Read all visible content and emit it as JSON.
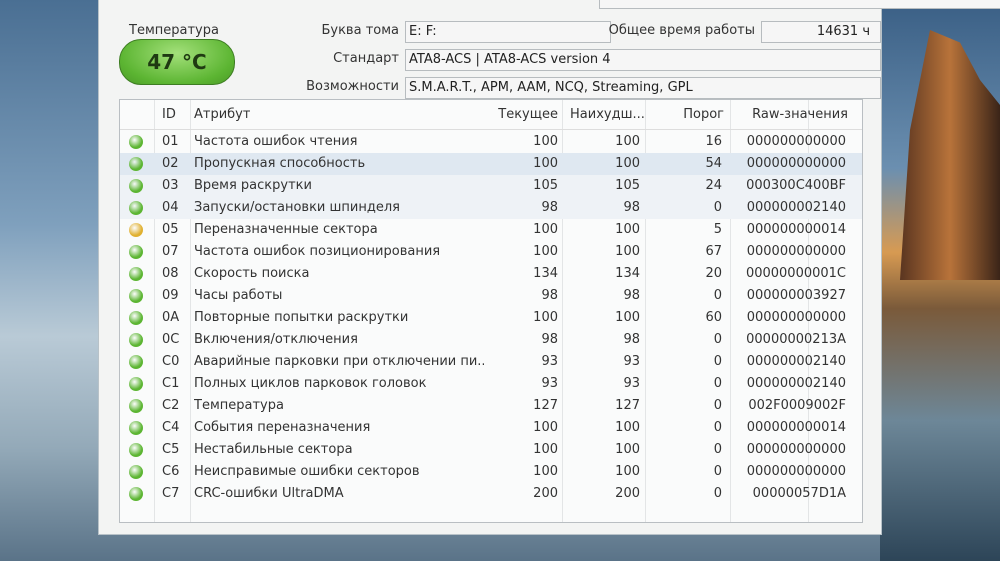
{
  "info": {
    "temperature_label": "Температура",
    "temperature_value": "47 °C",
    "volume_label": "Буква тома",
    "volume_value": "E: F:",
    "power_on_label": "Общее время работы",
    "power_on_value": "14631 ч",
    "standard_label": "Стандарт",
    "standard_value": "ATA8-ACS | ATA8-ACS version 4",
    "features_label": "Возможности",
    "features_value": "S.M.A.R.T., APM, AAM, NCQ, Streaming, GPL"
  },
  "colors": {
    "good": "#5cb532",
    "caution": "#e0b030",
    "temp_badge": "#5cb532"
  },
  "table": {
    "headers": {
      "id": "ID",
      "attribute": "Атрибут",
      "current": "Текущее",
      "worst": "Наихудш...",
      "threshold": "Порог",
      "raw": "Raw-значения"
    },
    "rows": [
      {
        "status": "good",
        "id": "01",
        "attribute": "Частота ошибок чтения",
        "current": "100",
        "worst": "100",
        "threshold": "16",
        "raw": "000000000000"
      },
      {
        "status": "good",
        "id": "02",
        "attribute": "Пропускная способность",
        "current": "100",
        "worst": "100",
        "threshold": "54",
        "raw": "000000000000"
      },
      {
        "status": "good",
        "id": "03",
        "attribute": "Время раскрутки",
        "current": "105",
        "worst": "105",
        "threshold": "24",
        "raw": "000300C400BF"
      },
      {
        "status": "good",
        "id": "04",
        "attribute": "Запуски/остановки шпинделя",
        "current": "98",
        "worst": "98",
        "threshold": "0",
        "raw": "000000002140"
      },
      {
        "status": "caution",
        "id": "05",
        "attribute": "Переназначенные сектора",
        "current": "100",
        "worst": "100",
        "threshold": "5",
        "raw": "000000000014"
      },
      {
        "status": "good",
        "id": "07",
        "attribute": "Частота ошибок позиционирования",
        "current": "100",
        "worst": "100",
        "threshold": "67",
        "raw": "000000000000"
      },
      {
        "status": "good",
        "id": "08",
        "attribute": "Скорость поиска",
        "current": "134",
        "worst": "134",
        "threshold": "20",
        "raw": "00000000001C"
      },
      {
        "status": "good",
        "id": "09",
        "attribute": "Часы работы",
        "current": "98",
        "worst": "98",
        "threshold": "0",
        "raw": "000000003927"
      },
      {
        "status": "good",
        "id": "0A",
        "attribute": "Повторные попытки раскрутки",
        "current": "100",
        "worst": "100",
        "threshold": "60",
        "raw": "000000000000"
      },
      {
        "status": "good",
        "id": "0C",
        "attribute": "Включения/отключения",
        "current": "98",
        "worst": "98",
        "threshold": "0",
        "raw": "00000000213A"
      },
      {
        "status": "good",
        "id": "C0",
        "attribute": "Аварийные парковки при отключении пи...",
        "current": "93",
        "worst": "93",
        "threshold": "0",
        "raw": "000000002140"
      },
      {
        "status": "good",
        "id": "C1",
        "attribute": "Полных циклов парковок головок",
        "current": "93",
        "worst": "93",
        "threshold": "0",
        "raw": "000000002140"
      },
      {
        "status": "good",
        "id": "C2",
        "attribute": "Температура",
        "current": "127",
        "worst": "127",
        "threshold": "0",
        "raw": "002F0009002F"
      },
      {
        "status": "good",
        "id": "C4",
        "attribute": "События переназначения",
        "current": "100",
        "worst": "100",
        "threshold": "0",
        "raw": "000000000014"
      },
      {
        "status": "good",
        "id": "C5",
        "attribute": "Нестабильные сектора",
        "current": "100",
        "worst": "100",
        "threshold": "0",
        "raw": "000000000000"
      },
      {
        "status": "good",
        "id": "C6",
        "attribute": "Неисправимые ошибки секторов",
        "current": "100",
        "worst": "100",
        "threshold": "0",
        "raw": "000000000000"
      },
      {
        "status": "good",
        "id": "C7",
        "attribute": "CRC-ошибки UltraDMA",
        "current": "200",
        "worst": "200",
        "threshold": "0",
        "raw": "00000057D1A"
      }
    ]
  }
}
